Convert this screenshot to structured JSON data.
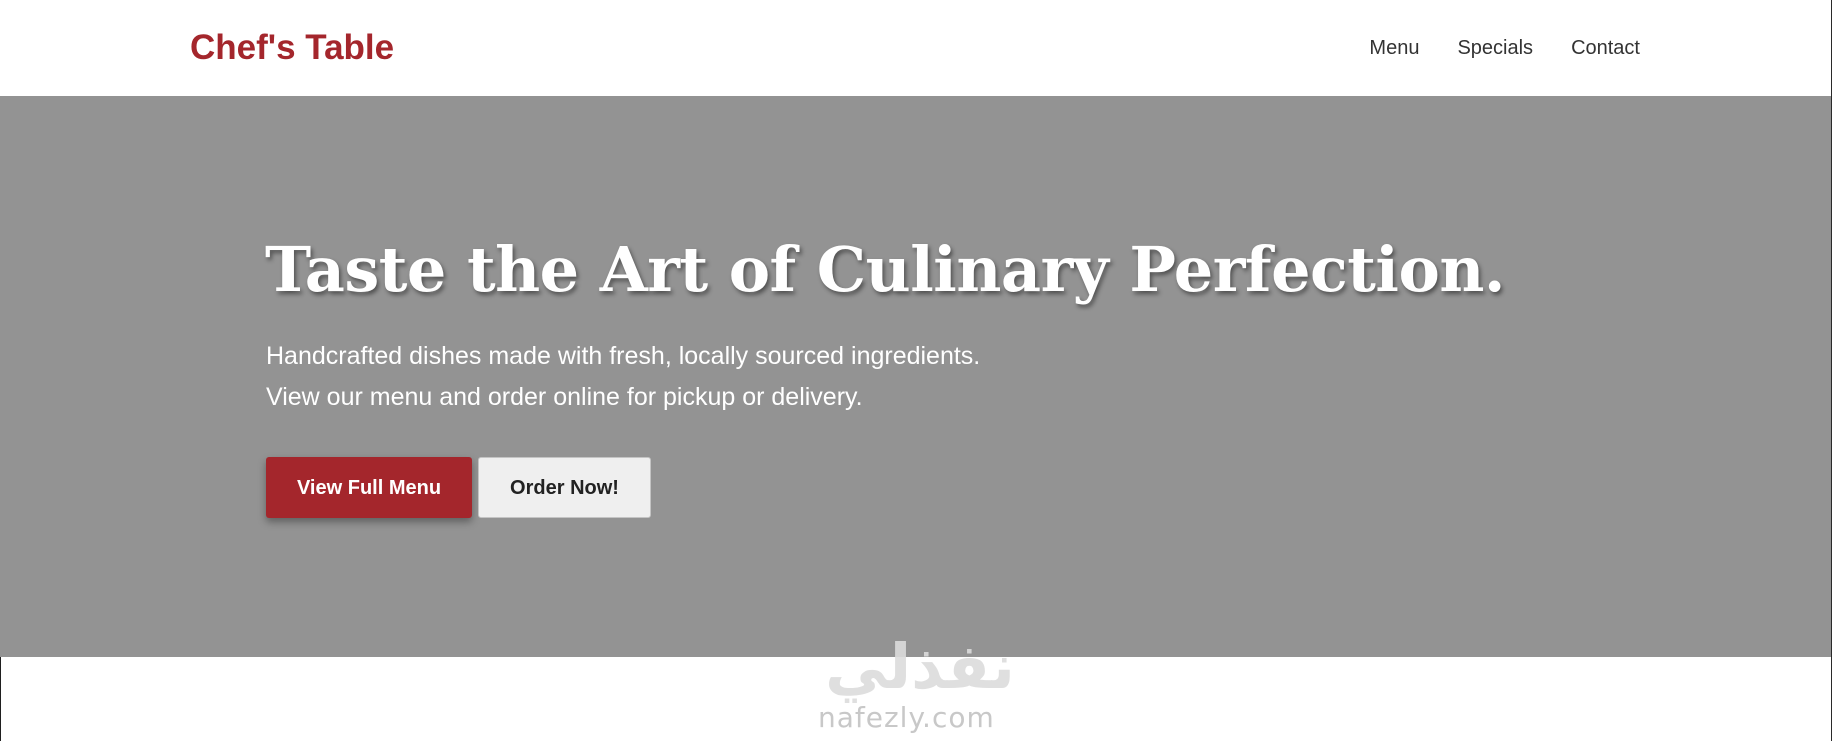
{
  "header": {
    "brand": "Chef's Table",
    "nav": [
      "Menu",
      "Specials",
      "Contact"
    ]
  },
  "hero": {
    "title": "Taste the Art of Culinary Perfection.",
    "subtitle_line1": "Handcrafted dishes made with fresh, locally sourced ingredients.",
    "subtitle_line2": "View our menu and order online for pickup or delivery.",
    "primary_button": "View Full Menu",
    "secondary_button": "Order Now!"
  },
  "watermark": {
    "arabic_text": "نفذلي",
    "latin_text": "nafezly.com"
  },
  "colors": {
    "brand": "#a4262c",
    "hero_background": "#939393",
    "secondary_button_bg": "#efefef"
  }
}
